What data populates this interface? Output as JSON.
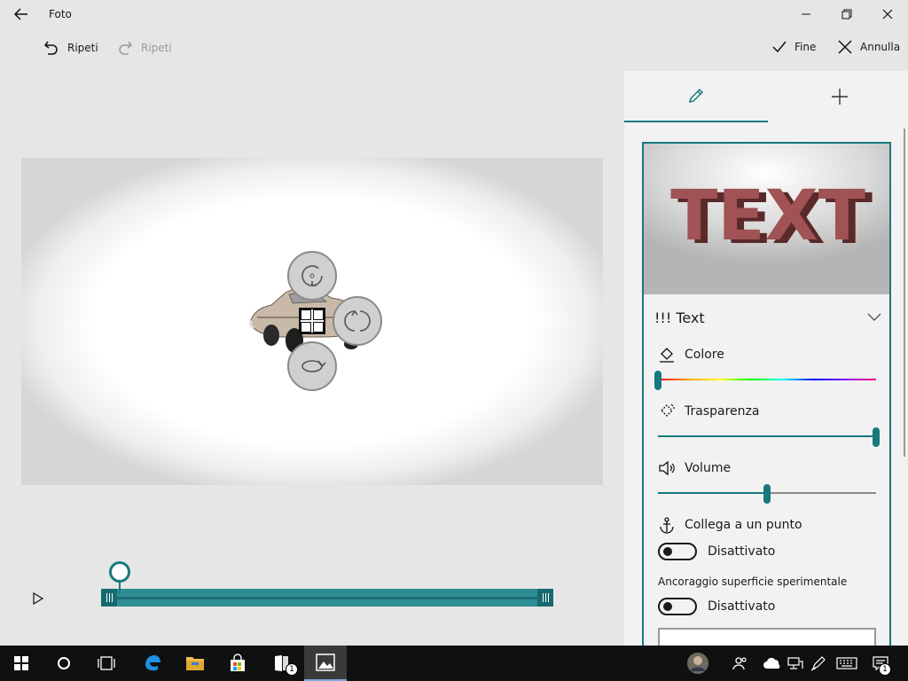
{
  "window": {
    "title": "Foto"
  },
  "commands": {
    "undo": "Ripeti",
    "redo": "Ripeti",
    "done": "Fine",
    "cancel": "Annulla"
  },
  "panel": {
    "effect_name": "!!! Text",
    "preview_text": "TEXT",
    "color_label": "Colore",
    "color_level": 0.0,
    "transparency_label": "Trasparenza",
    "transparency_level": 1.0,
    "volume_label": "Volume",
    "volume_level": 0.5,
    "anchor_label": "Collega a un punto",
    "anchor_toggle_state": "Disattivato",
    "surface_label": "Ancoraggio superficie sperimentale",
    "surface_toggle_state": "Disattivato"
  },
  "timeline": {
    "playhead_fraction": 0.04
  },
  "taskbar": {
    "badge_explorer": "1",
    "badge_notifications": "1"
  },
  "colors": {
    "accent": "#17797e",
    "track": "#2f8e93",
    "taskbar": "#101010"
  }
}
